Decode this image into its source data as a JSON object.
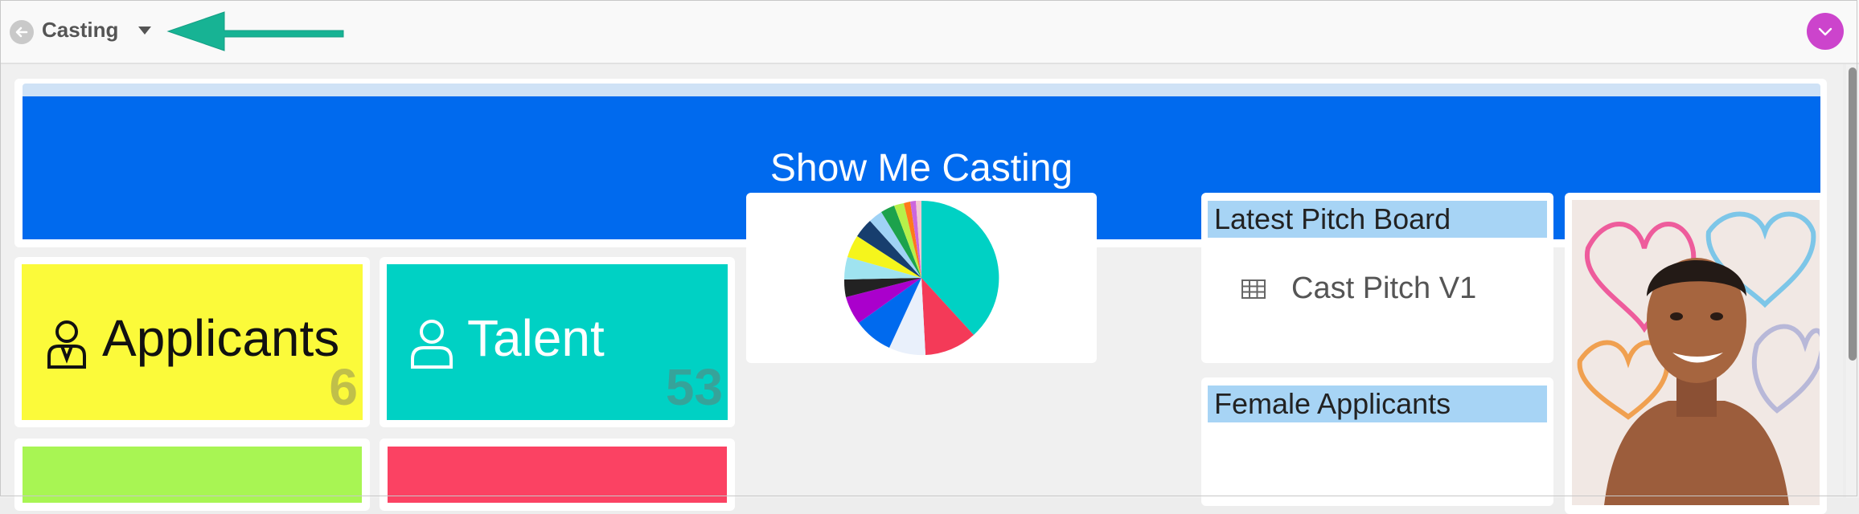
{
  "header": {
    "title": "Casting"
  },
  "banner": {
    "title": "Show Me Casting"
  },
  "tiles": [
    {
      "label": "Applicants",
      "count": "6"
    },
    {
      "label": "Talent",
      "count": "53"
    }
  ],
  "pitch_board": {
    "header": "Latest Pitch Board",
    "items": [
      {
        "label": "Cast Pitch V1",
        "icon": "table-grid-icon"
      }
    ]
  },
  "female_applicants": {
    "header": "Female Applicants"
  },
  "colors": {
    "accent": "#006aee",
    "applicants": "#fbfa3a",
    "talent": "#00d1c4",
    "green_tile": "#a8f553",
    "red_tile": "#fb4263",
    "annotation_arrow": "#17b394",
    "user_menu": "#cc44cc"
  }
}
